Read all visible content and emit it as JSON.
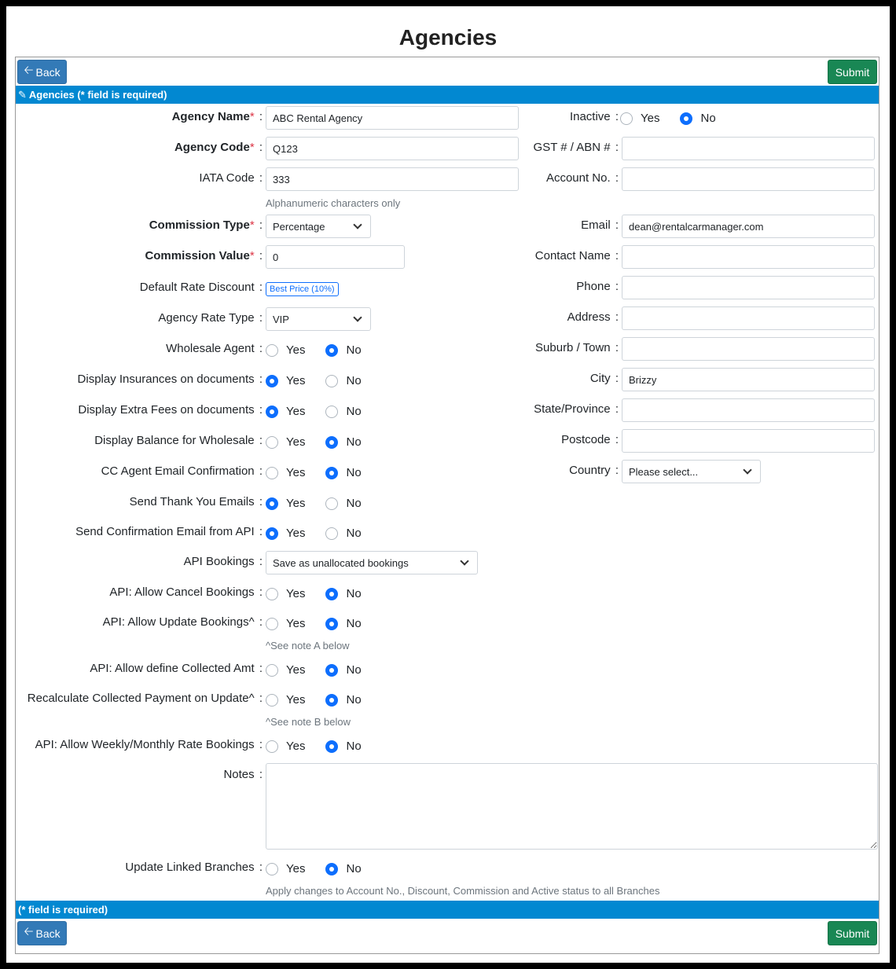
{
  "page": {
    "title": "Agencies"
  },
  "toolbar": {
    "back_label": "Back",
    "submit_label": "Submit"
  },
  "header_bar": {
    "text": "Agencies (* field is required)"
  },
  "footer_bar": {
    "text": "(* field is required)"
  },
  "options": {
    "yes": "Yes",
    "no": "No"
  },
  "fields": {
    "agency_name": {
      "label": "Agency Name",
      "value": "ABC Rental Agency"
    },
    "agency_code": {
      "label": "Agency Code",
      "value": "Q123"
    },
    "iata_code": {
      "label": "IATA Code",
      "value": "333",
      "hint": "Alphanumeric characters only"
    },
    "commission_type": {
      "label": "Commission Type",
      "value": "Percentage"
    },
    "commission_value": {
      "label": "Commission Value",
      "value": "0"
    },
    "default_rate_discount": {
      "label": "Default Rate Discount",
      "value": "Best Price (10%)"
    },
    "agency_rate_type": {
      "label": "Agency Rate Type",
      "value": "VIP"
    },
    "wholesale_agent": {
      "label": "Wholesale Agent",
      "selected": "No"
    },
    "display_insurances": {
      "label": "Display Insurances on documents",
      "selected": "Yes"
    },
    "display_extra_fees": {
      "label": "Display Extra Fees on documents",
      "selected": "Yes"
    },
    "display_balance": {
      "label": "Display Balance for Wholesale",
      "selected": "No"
    },
    "cc_agent_email": {
      "label": "CC Agent Email Confirmation",
      "selected": "No"
    },
    "send_thank_you": {
      "label": "Send Thank You Emails",
      "selected": "Yes"
    },
    "send_confirmation_api": {
      "label": "Send Confirmation Email from API",
      "selected": "Yes"
    },
    "api_bookings": {
      "label": "API Bookings",
      "value": "Save as unallocated bookings"
    },
    "api_allow_cancel": {
      "label": "API: Allow Cancel Bookings",
      "selected": "No"
    },
    "api_allow_update": {
      "label": "API: Allow Update Bookings^",
      "selected": "No",
      "hint": "^See note A below"
    },
    "api_allow_collected": {
      "label": "API: Allow define Collected Amt",
      "selected": "No"
    },
    "recalculate_collected": {
      "label": "Recalculate Collected Payment on Update^",
      "selected": "No",
      "hint": "^See note B below"
    },
    "api_allow_weekly": {
      "label": "API: Allow Weekly/Monthly Rate Bookings",
      "selected": "No"
    },
    "notes": {
      "label": "Notes",
      "value": ""
    },
    "update_linked_branches": {
      "label": "Update Linked Branches",
      "selected": "No",
      "hint": "Apply changes to Account No., Discount, Commission and Active status to all Branches"
    },
    "inactive": {
      "label": "Inactive",
      "selected": "No"
    },
    "gst_abn": {
      "label": "GST # / ABN #",
      "value": ""
    },
    "account_no": {
      "label": "Account No.",
      "value": ""
    },
    "email": {
      "label": "Email",
      "value": "dean@rentalcarmanager.com"
    },
    "contact_name": {
      "label": "Contact Name",
      "value": ""
    },
    "phone": {
      "label": "Phone",
      "value": ""
    },
    "address": {
      "label": "Address",
      "value": ""
    },
    "suburb_town": {
      "label": "Suburb / Town",
      "value": ""
    },
    "city": {
      "label": "City",
      "value": "Brizzy"
    },
    "state_province": {
      "label": "State/Province",
      "value": ""
    },
    "postcode": {
      "label": "Postcode",
      "value": ""
    },
    "country": {
      "label": "Country",
      "value": "Please select..."
    }
  },
  "colors": {
    "primary": "#0d6efd",
    "back_button": "#337ab7",
    "submit_button": "#198754",
    "bar": "#0288d1",
    "required": "#dc3545"
  }
}
